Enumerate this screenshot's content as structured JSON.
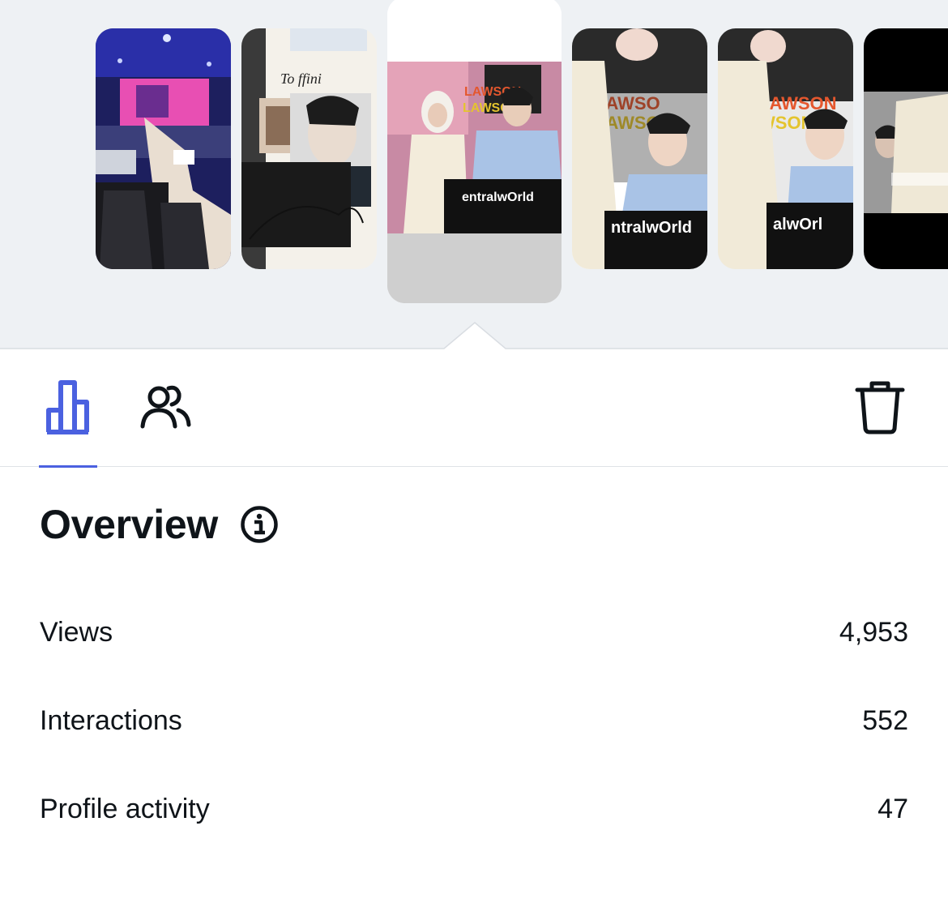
{
  "stories": [
    {
      "id": "concert",
      "caption": "",
      "selected": false
    },
    {
      "id": "signed-photo",
      "caption": "To ffini",
      "selected": false
    },
    {
      "id": "fansign-1",
      "caption": "entralwOrld",
      "selected": true
    },
    {
      "id": "fansign-2",
      "caption": "ntralwOrld",
      "selected": false
    },
    {
      "id": "fansign-3",
      "caption": "alwOrl",
      "selected": false
    },
    {
      "id": "fansign-4",
      "caption": "",
      "selected": false
    }
  ],
  "tabs": [
    {
      "name": "analytics",
      "icon": "bar-chart-icon",
      "active": true
    },
    {
      "name": "viewers",
      "icon": "people-icon",
      "active": false
    }
  ],
  "actions": {
    "delete_icon": "trash-icon"
  },
  "overview": {
    "title": "Overview",
    "info_icon": "info-icon",
    "stats": [
      {
        "label": "Views",
        "value": "4,953"
      },
      {
        "label": "Interactions",
        "value": "552"
      },
      {
        "label": "Profile activity",
        "value": "47"
      }
    ]
  },
  "colors": {
    "accent": "#4b61e0",
    "tray_background": "#eef1f4",
    "text": "#0f1419",
    "divider": "#dfe3e7"
  }
}
